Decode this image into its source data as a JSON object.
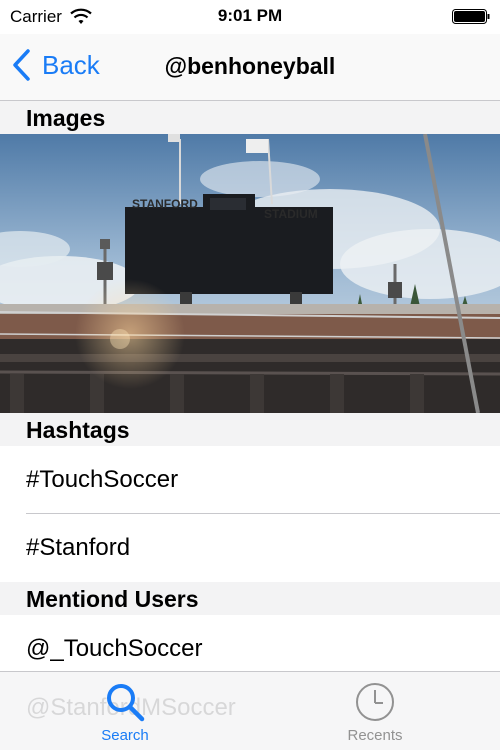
{
  "status_bar": {
    "carrier": "Carrier",
    "time": "9:01 PM"
  },
  "nav": {
    "back_label": "Back",
    "title": "@benhoneyball"
  },
  "sections": {
    "images_header": "Images",
    "image_signs": {
      "left": "STANFORD",
      "right": "STADIUM"
    },
    "hashtags_header": "Hashtags",
    "hashtags": [
      "#TouchSoccer",
      "#Stanford"
    ],
    "users_header": "Mentiond Users",
    "users": [
      "@_TouchSoccer",
      "@StanfordMSoccer"
    ]
  },
  "tab_bar": {
    "tabs": [
      {
        "label": "Search",
        "icon": "search-icon",
        "selected": true
      },
      {
        "label": "Recents",
        "icon": "clock-icon",
        "selected": false
      }
    ]
  },
  "colors": {
    "accent": "#1a7cf6",
    "inactive": "#929292",
    "section_bg": "#f3f3f4"
  }
}
